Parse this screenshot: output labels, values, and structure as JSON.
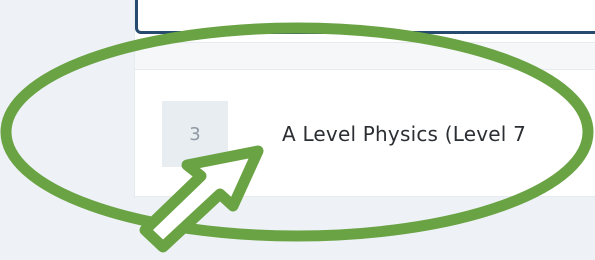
{
  "course_list": {
    "rows": [
      {
        "number": "3",
        "title": "A Level Physics (Level 7"
      }
    ]
  },
  "colors": {
    "annotation": "#6aa344",
    "input_border": "#274a6f"
  }
}
